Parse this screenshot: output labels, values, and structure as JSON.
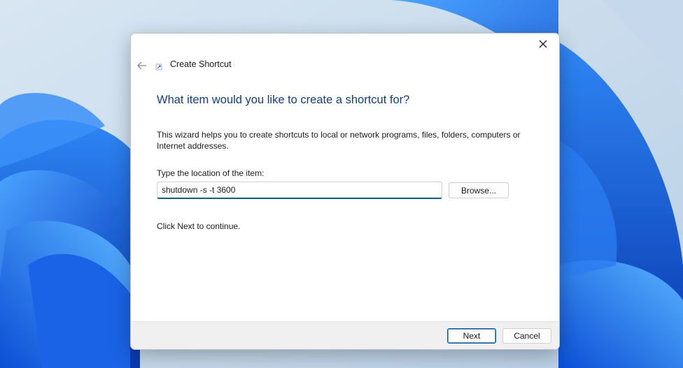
{
  "wallpaper": {
    "icon": "windows-bloom-wallpaper"
  },
  "window": {
    "title": "Create Shortcut",
    "title_icon": "shortcut-icon",
    "back_icon": "back-arrow-icon",
    "close_icon": "close-icon"
  },
  "main": {
    "heading": "What item would you like to create a shortcut for?",
    "description": "This wizard helps you to create shortcuts to local or network programs, files, folders, computers or Internet addresses.",
    "field_label": "Type the location of the item:",
    "location_value": "shutdown -s -t 3600",
    "browse_label": "Browse...",
    "continue_text": "Click Next to continue."
  },
  "footer": {
    "next_label": "Next",
    "cancel_label": "Cancel"
  },
  "colors": {
    "accent": "#0a5ea6",
    "heading": "#0f3f8c",
    "wallpaper_blue": "#1e6fe8"
  }
}
